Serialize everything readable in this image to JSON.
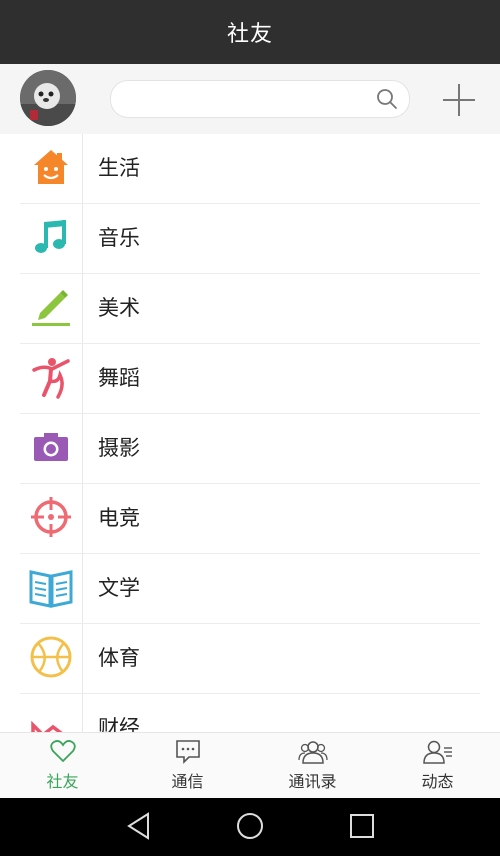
{
  "header": {
    "title": "社友"
  },
  "search": {
    "placeholder": ""
  },
  "categories": [
    {
      "label": "生活",
      "icon": "house-icon",
      "color": "#f5872a"
    },
    {
      "label": "音乐",
      "icon": "music-note-icon",
      "color": "#2bb8b0"
    },
    {
      "label": "美术",
      "icon": "pencil-icon",
      "color": "#8cc63f"
    },
    {
      "label": "舞蹈",
      "icon": "dancer-icon",
      "color": "#e9546b"
    },
    {
      "label": "摄影",
      "icon": "camera-icon",
      "color": "#9b59b6"
    },
    {
      "label": "电竞",
      "icon": "crosshair-icon",
      "color": "#ef6b73"
    },
    {
      "label": "文学",
      "icon": "book-icon",
      "color": "#3fa9d6"
    },
    {
      "label": "体育",
      "icon": "basketball-icon",
      "color": "#f3c14b"
    },
    {
      "label": "财经",
      "icon": "finance-icon",
      "color": "#e9546b"
    }
  ],
  "tabs": [
    {
      "label": "社友",
      "icon": "heart-icon",
      "active": true
    },
    {
      "label": "通信",
      "icon": "chat-bubble-icon",
      "active": false
    },
    {
      "label": "通讯录",
      "icon": "contacts-icon",
      "active": false
    },
    {
      "label": "动态",
      "icon": "user-list-icon",
      "active": false
    }
  ],
  "colors": {
    "accent": "#3aa55a",
    "titlebar": "#2f2f2f"
  }
}
